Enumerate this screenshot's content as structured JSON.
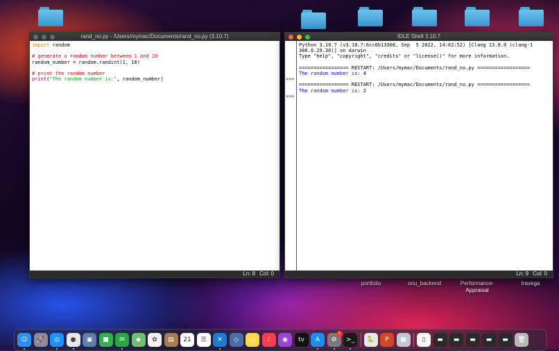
{
  "desktop": {
    "folders": [
      {
        "name": "folder-top-left"
      },
      {
        "name": "folder-top-1"
      },
      {
        "name": "folder-top-2"
      },
      {
        "name": "folder-top-3"
      },
      {
        "name": "folder-top-4"
      },
      {
        "name": "folder-top-5"
      }
    ],
    "labels": {
      "portfolio": "portfolio",
      "onu_backend": "onu_backend",
      "performance_line1": "Performance-",
      "performance_line2": "Appraisal",
      "travega": "travega"
    }
  },
  "editor": {
    "title": "rand_no.py - /Users/mymac/Documents/rand_no.py (3.10.7)",
    "status_ln": "Ln: 8",
    "status_col": "Col: 0",
    "lines": [
      [
        {
          "t": "import",
          "c": "kw"
        },
        {
          "t": " random",
          "c": ""
        }
      ],
      [],
      [
        {
          "t": "# generate a random number between 1 and 10",
          "c": "cm"
        }
      ],
      [
        {
          "t": "random_number = random.randint(1, 10)",
          "c": ""
        }
      ],
      [],
      [
        {
          "t": "# print the random number",
          "c": "cm"
        }
      ],
      [
        {
          "t": "print",
          "c": "bi"
        },
        {
          "t": "(",
          "c": ""
        },
        {
          "t": "\"The random number is:\"",
          "c": "st"
        },
        {
          "t": ", random_number)",
          "c": ""
        }
      ]
    ]
  },
  "shell": {
    "title": "IDLE Shell 3.10.7",
    "status_ln": "Ln: 9",
    "status_col": "Col: 0",
    "prompt": ">>>",
    "lines": [
      [
        {
          "t": "Python 3.10.7 (v3.10.7:6cc6b13308, Sep  5 2022, 14:02:52) [Clang 13.0.0 (clang-1",
          "c": ""
        }
      ],
      [
        {
          "t": "300.0.29.30)] on darwin",
          "c": ""
        }
      ],
      [
        {
          "t": "Type \"help\", \"copyright\", \"credits\" or \"license()\" for more information.",
          "c": ""
        }
      ],
      [],
      [
        {
          "t": "================= RESTART: /Users/mymac/Documents/rand_no.py ==================",
          "c": ""
        }
      ],
      [
        {
          "t": "The random number is: 4",
          "c": "out"
        }
      ],
      [],
      [
        {
          "t": "================= RESTART: /Users/mymac/Documents/rand_no.py ==================",
          "c": ""
        }
      ],
      [
        {
          "t": "The random number is: 2",
          "c": "out"
        }
      ]
    ],
    "prompt_rows": [
      6,
      9
    ]
  },
  "dock": {
    "calendar_day": "21",
    "badge_count": "1",
    "tv_label": "tv",
    "apps": [
      {
        "name": "finder-icon",
        "bg": "#2e8ff0",
        "glyph": "☺"
      },
      {
        "name": "launchpad-icon",
        "bg": "#8a8a9a",
        "glyph": "🚀"
      },
      {
        "name": "safari-icon",
        "bg": "#1e90ff",
        "glyph": "◎"
      },
      {
        "name": "chrome-icon",
        "bg": "#e8e8e8",
        "glyph": "●"
      },
      {
        "name": "preview-icon",
        "bg": "#5a7fa8",
        "glyph": "▣"
      },
      {
        "name": "facetime-icon",
        "bg": "#2fb34a",
        "glyph": "■"
      },
      {
        "name": "messages-icon",
        "bg": "#28a745",
        "glyph": "✉"
      },
      {
        "name": "maps-icon",
        "bg": "#6fbf73",
        "glyph": "◆"
      },
      {
        "name": "photos-icon",
        "bg": "#f2f2f2",
        "glyph": "✿"
      },
      {
        "name": "notes-brown-icon",
        "bg": "#a67c52",
        "glyph": "▤"
      },
      {
        "name": "calendar-icon",
        "bg": "#ffffff",
        "glyph": ""
      },
      {
        "name": "reminders-icon",
        "bg": "#ffffff",
        "glyph": "☰"
      },
      {
        "name": "vscode-icon",
        "bg": "#1f7ad1",
        "glyph": "✕"
      },
      {
        "name": "virtualbox-icon",
        "bg": "#4a6fa5",
        "glyph": "◇"
      },
      {
        "name": "notes-icon",
        "bg": "#ffd84a",
        "glyph": "▭"
      },
      {
        "name": "music-icon",
        "bg": "#fa3c4c",
        "glyph": "♪"
      },
      {
        "name": "podcasts-icon",
        "bg": "#9b45d6",
        "glyph": "◉"
      },
      {
        "name": "appletv-icon",
        "bg": "#111111",
        "glyph": ""
      },
      {
        "name": "appstore-icon",
        "bg": "#1c8ef2",
        "glyph": "A"
      },
      {
        "name": "system-preferences-icon",
        "bg": "#7a7a7a",
        "glyph": "⚙"
      },
      {
        "name": "terminal-icon",
        "bg": "#1a1a1a",
        "glyph": ">_"
      },
      {
        "name": "python-launcher-icon",
        "bg": "#e8e8e8",
        "glyph": "🐍"
      },
      {
        "name": "powerpoint-icon",
        "bg": "#d24726",
        "glyph": "P"
      },
      {
        "name": "screenshot-icon",
        "bg": "#c0c8d0",
        "glyph": "▦"
      },
      {
        "name": "document-icon",
        "bg": "#f5f5f5",
        "glyph": "▯"
      },
      {
        "name": "minimized-window-1-icon",
        "bg": "#2a2a2a",
        "glyph": "▬"
      },
      {
        "name": "minimized-window-2-icon",
        "bg": "#2a2a2a",
        "glyph": "▬"
      },
      {
        "name": "minimized-window-3-icon",
        "bg": "#2a2a2a",
        "glyph": "▬"
      },
      {
        "name": "minimized-window-4-icon",
        "bg": "#2a2a2a",
        "glyph": "▬"
      },
      {
        "name": "minimized-window-5-icon",
        "bg": "#2a2a2a",
        "glyph": "▬"
      },
      {
        "name": "trash-icon",
        "bg": "#b8b8b8",
        "glyph": "🗑"
      }
    ]
  },
  "colors": {
    "close": "#ff5f57",
    "minimize": "#febc2e",
    "zoom": "#28c840",
    "inactive": "#6a6a6a"
  }
}
